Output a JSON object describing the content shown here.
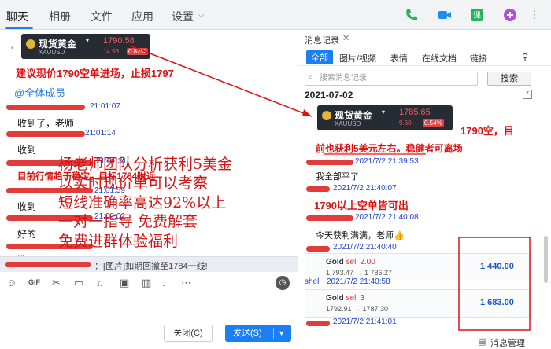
{
  "tabs": [
    {
      "label": "聊天",
      "active": true
    },
    {
      "label": "相册"
    },
    {
      "label": "文件"
    },
    {
      "label": "应用"
    },
    {
      "label": "设置"
    }
  ],
  "topicons": [
    "phone-icon",
    "video-icon",
    "lesson-icon",
    "add-icon"
  ],
  "colors": {
    "accent": "#1b7ef2",
    "annotation": "#e01010",
    "timestamp": "#2243c9"
  },
  "chat": {
    "card1": {
      "name": "现货黄金",
      "code": "XAUUSD",
      "price": "1790.58",
      "change": "14.53",
      "pct": "0.82%"
    },
    "advice": "建议现价1790空单进场，止损1797",
    "mention": "@全体成员",
    "msgs": [
      {
        "ts": "21:01:07",
        "text": "收到了，老师"
      },
      {
        "ts": "21:01:14",
        "text": "收到"
      },
      {
        "ts": "21:01:31",
        "text": "目前行情趋于稳定，目标1784附近"
      },
      {
        "ts": "21:01:59",
        "text": "收到"
      },
      {
        "ts": "21:02:02",
        "text": "好的"
      },
      {
        "text": "进了"
      }
    ],
    "overlay": [
      "杨老师团队分析获利5美金",
      "以实时现价单可以考察",
      "短线准确率高达92%以上",
      "一对一指导    免费解套",
      "免费进群体验福利"
    ],
    "quote": "：[图片]如期回撤至1784一线!",
    "close_label": "关闭(C)",
    "send_label": "发送(S)"
  },
  "panel": {
    "title": "消息记录",
    "filters": [
      "全部",
      "图片/视频",
      "表情",
      "在线文档",
      "链接"
    ],
    "search_placeholder": "搜索消息记录",
    "search_btn": "搜索",
    "date": "2021-07-02",
    "card2": {
      "name": "现货黄金",
      "code": "XAUUSD",
      "price": "1785.65",
      "change": "9.60",
      "pct": "0.54%"
    },
    "note1": "1790空，目",
    "note2": "前也获利5美元左右。稳健者可离场",
    "msgs": [
      {
        "ts": "2021/7/2 21:39:53",
        "text": "我全部平了"
      },
      {
        "ts": "2021/7/2 21:40:07",
        "text": ""
      },
      {
        "ts": "2021/7/2 21:40:08",
        "text": "今天获利满满，老师👍"
      },
      {
        "ts": "2021/7/2 21:40:40",
        "text": ""
      }
    ],
    "note3": "1790以上空单皆可出",
    "trades": [
      {
        "name": "Gold",
        "side": "sell 2.00",
        "range": "1 793.47 → 1 786.27",
        "amount": "1 440.00"
      },
      {
        "prefix": "shell",
        "ts": "2021/7/2 21:40:58",
        "name": "Gold",
        "side": "sell 3",
        "range": "1792.91 → 1787.30",
        "amount": "1 683.00"
      }
    ],
    "last_ts": "2021/7/2 21:41:01",
    "manager": "消息管理"
  }
}
